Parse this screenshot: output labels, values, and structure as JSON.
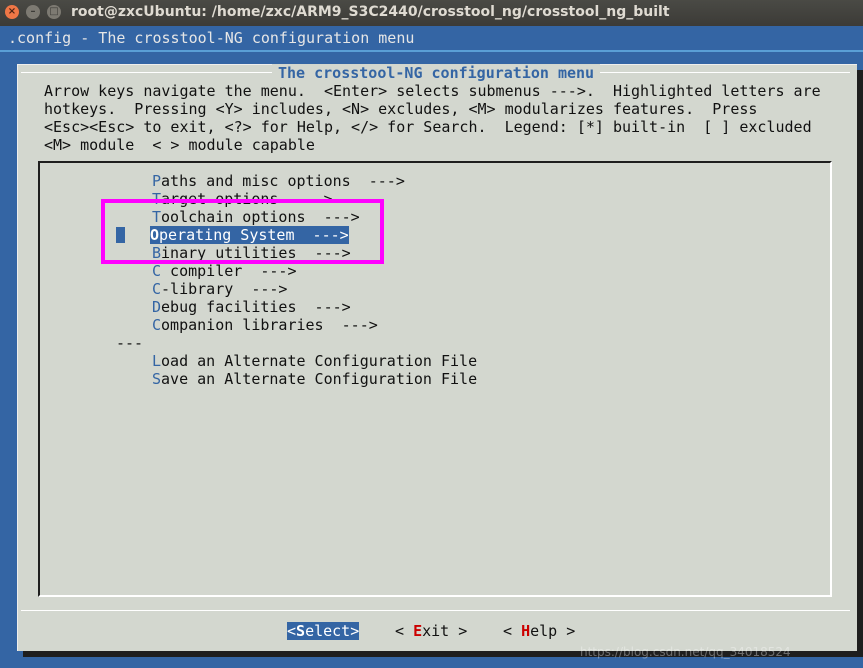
{
  "window": {
    "title": "root@zxcUbuntu: /home/zxc/ARM9_S3C2440/crosstool_ng/crosstool_ng_built",
    "close_glyph": "×",
    "min_glyph": "–",
    "max_glyph": "□"
  },
  "header": ".config - The crosstool-NG configuration menu",
  "dialog": {
    "title": "The crosstool-NG configuration menu",
    "help_lines": [
      "Arrow keys navigate the menu.  <Enter> selects submenus --->.  Highlighted letters are",
      "hotkeys.  Pressing <Y> includes, <N> excludes, <M> modularizes features.  Press",
      "<Esc><Esc> to exit, <?> for Help, </> for Search.  Legend: [*] built-in  [ ] excluded",
      "<M> module  < > module capable"
    ]
  },
  "menu": {
    "items": [
      {
        "hotkey": "P",
        "rest": "aths and misc options  --->"
      },
      {
        "hotkey": "T",
        "rest": "arget options  --->"
      },
      {
        "hotkey": "T",
        "rest": "oolchain options  --->"
      },
      {
        "hotkey": "O",
        "rest": "perating System  --->"
      },
      {
        "hotkey": "B",
        "rest": "inary utilities  --->"
      },
      {
        "hotkey": "C",
        "rest": " compiler  --->"
      },
      {
        "hotkey": "C",
        "rest": "-library  --->"
      },
      {
        "hotkey": "D",
        "rest": "ebug facilities  --->"
      },
      {
        "hotkey": "C",
        "rest": "ompanion libraries  --->"
      },
      {
        "hotkey": "L",
        "rest": "oad an Alternate Configuration File"
      },
      {
        "hotkey": "S",
        "rest": "ave an Alternate Configuration File"
      }
    ],
    "separator": "---",
    "selected_index": 3
  },
  "buttons": {
    "select": {
      "pre": "<",
      "hotkey": "S",
      "post": "elect>"
    },
    "exit": {
      "pre": "< ",
      "hotkey": "E",
      "post": "xit >"
    },
    "help": {
      "pre": "< ",
      "hotkey": "H",
      "post": "elp >"
    }
  },
  "watermark": "https://blog.csdn.net/qq_34018524",
  "colors": {
    "accent": "#3465a4",
    "panel": "#d3d7cf",
    "highlight_box": "#ff00ff",
    "button_hotkey": "#cc0000"
  }
}
